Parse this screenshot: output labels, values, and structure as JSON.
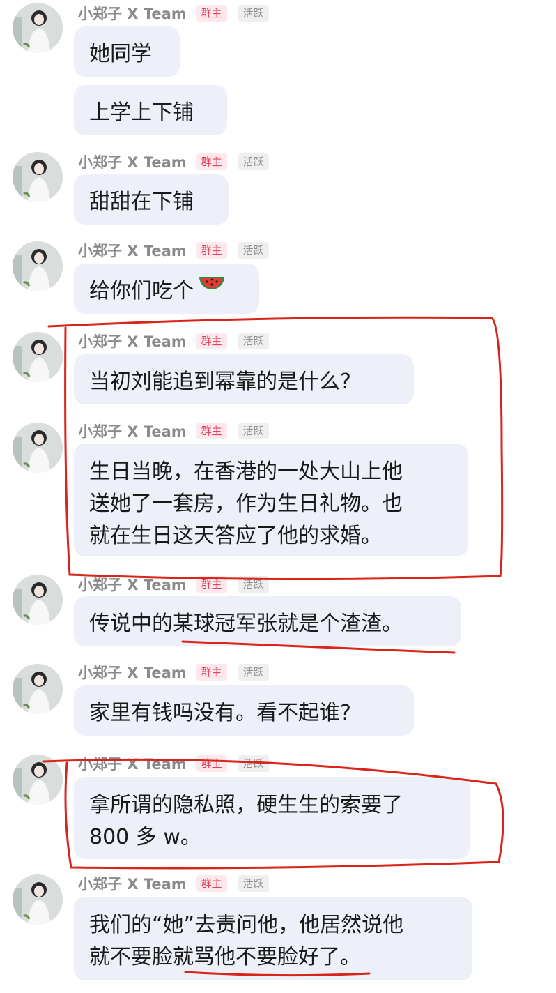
{
  "chat": {
    "sender_name": "小郑子 X Team",
    "badge_owner": "群主",
    "badge_active": "活跃",
    "colors": {
      "annotation": "#d9241a",
      "bubble": "#eef0f9",
      "owner_badge": "#e5405e"
    },
    "messages": [
      {
        "text": "她同学"
      },
      {
        "text": "上学上下铺"
      },
      {
        "text": "甜甜在下铺"
      },
      {
        "text": "给你们吃个",
        "emoji": "watermelon-icon"
      },
      {
        "text": "当初刘能追到幂靠的是什么?"
      },
      {
        "text": "生日当晚，在香港的一处大山上他",
        "line2": "送她了一套房，作为生日礼物。也",
        "line3": "就在生日这天答应了他的求婚。"
      },
      {
        "text": "传说中的某球冠军张就是个渣渣。"
      },
      {
        "text": "家里有钱吗没有。看不起谁?"
      },
      {
        "text": "拿所谓的隐私照，硬生生的索要了",
        "line2": "800 多 w。"
      },
      {
        "text": "我们的“她”去责问他，他居然说他",
        "line2": "就不要脸就骂他不要脸好了。"
      }
    ]
  }
}
